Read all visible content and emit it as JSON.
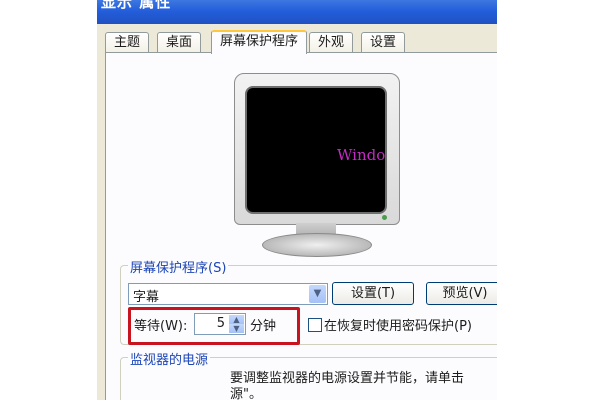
{
  "window": {
    "title": "显示 属性"
  },
  "tabs": [
    {
      "label": "主题",
      "active": false
    },
    {
      "label": "桌面",
      "active": false
    },
    {
      "label": "屏幕保护程序",
      "active": true
    },
    {
      "label": "外观",
      "active": false
    },
    {
      "label": "设置",
      "active": false
    }
  ],
  "preview": {
    "scroll_text": "Windows N"
  },
  "screensaver": {
    "group_label": "屏幕保护程序(S)",
    "selected": "字幕",
    "settings_button": "设置(T)",
    "preview_button": "预览(V)",
    "wait_label": "等待(W):",
    "wait_value": "5",
    "wait_unit": "分钟",
    "password_label": "在恢复时使用密码保护(P)",
    "password_checked": false
  },
  "power": {
    "group_label": "监视器的电源",
    "line1": "要调整监视器的电源设置并节能，请单击",
    "line2": "源\"。"
  },
  "colors": {
    "highlight": "#c8141e",
    "preview_text": "#c42ac4"
  }
}
